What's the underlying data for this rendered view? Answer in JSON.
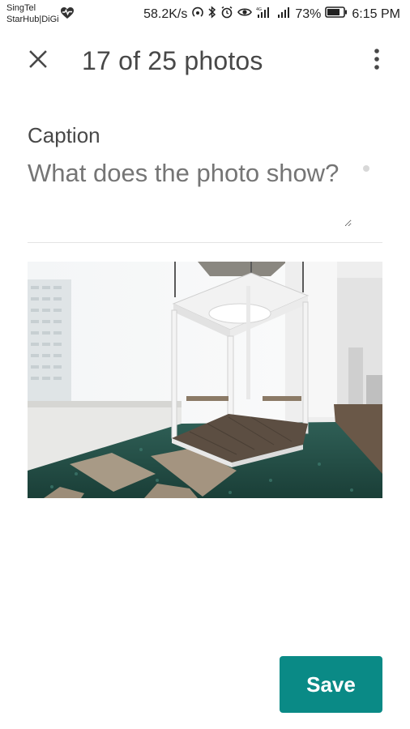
{
  "status_bar": {
    "carrier_line1": "SingTel",
    "carrier_line2": "StarHub|DiGi",
    "network_speed": "58.2K/s",
    "battery_percent": "73%",
    "time": "6:15 PM",
    "icons": [
      "heart-rate-icon",
      "hotspot-icon",
      "bluetooth-icon",
      "alarm-icon",
      "eye-icon",
      "signal-icon",
      "signal-icon",
      "battery-icon"
    ]
  },
  "header": {
    "title": "17 of 25 photos",
    "close_icon": "close-icon",
    "more_icon": "more-vertical-icon"
  },
  "caption": {
    "label": "Caption",
    "placeholder": "What does the photo show?",
    "value": ""
  },
  "photo": {
    "subject": "white hanging gazebo over pool"
  },
  "actions": {
    "save_label": "Save"
  },
  "colors": {
    "accent": "#0a8a86",
    "text_primary": "#484848",
    "placeholder": "#8a8a8a"
  }
}
